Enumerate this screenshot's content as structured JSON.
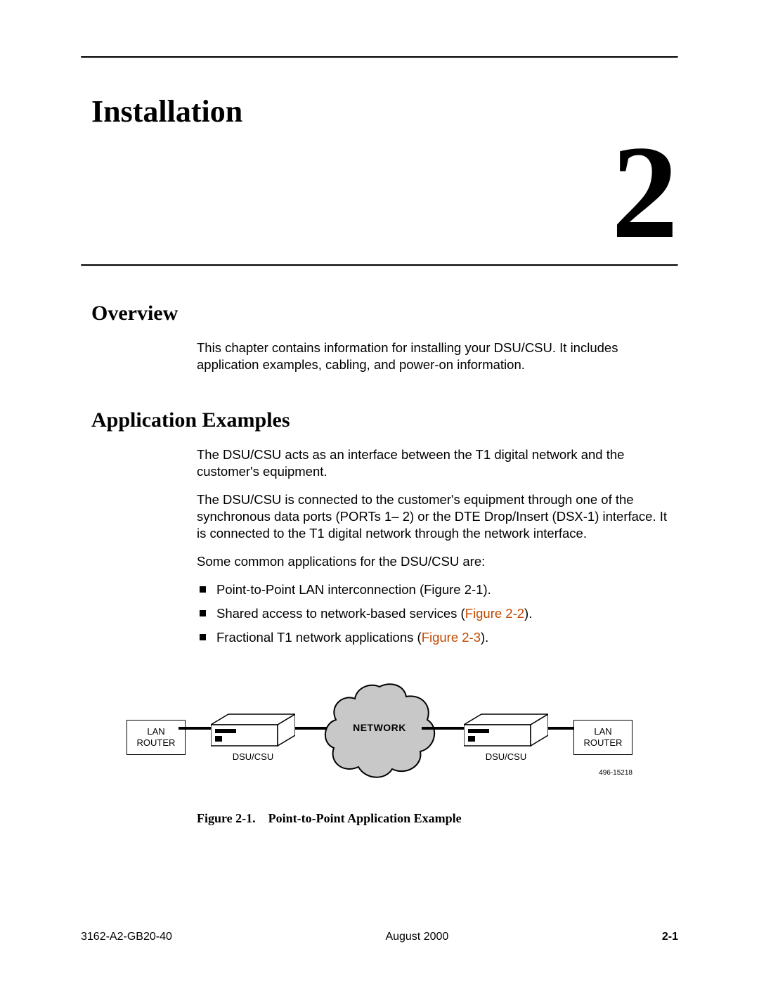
{
  "chapter": {
    "title": "Installation",
    "number": "2"
  },
  "sections": {
    "overview": {
      "title": "Overview",
      "p1": "This chapter contains information for installing your DSU/CSU. It includes application examples, cabling, and power-on information."
    },
    "appex": {
      "title": "Application Examples",
      "p1": "The DSU/CSU acts as an interface between the T1 digital network and the customer's equipment.",
      "p2": "The DSU/CSU is connected to the customer's equipment through one of the synchronous data ports (PORTs 1– 2) or the DTE Drop/Insert (DSX-1) interface. It is connected to the T1 digital network through the network interface.",
      "p3": "Some common applications for the DSU/CSU are:",
      "bullets": {
        "b1": "Point-to-Point LAN interconnection (Figure 2-1).",
        "b2a": "Shared access to network-based services (",
        "b2link": "Figure 2-2",
        "b2b": ").",
        "b3a": "Fractional T1 network applications (",
        "b3link": "Figure 2-3",
        "b3b": ")."
      }
    }
  },
  "figure": {
    "lan_label_line1": "LAN",
    "lan_label_line2": "ROUTER",
    "dsu_label": "DSU/CSU",
    "network_label": "NETWORK",
    "drawing_id": "496-15218",
    "caption_label": "Figure 2-1.",
    "caption_text": "Point-to-Point Application Example"
  },
  "footer": {
    "doc_id": "3162-A2-GB20-40",
    "date": "August 2000",
    "page": "2-1"
  }
}
